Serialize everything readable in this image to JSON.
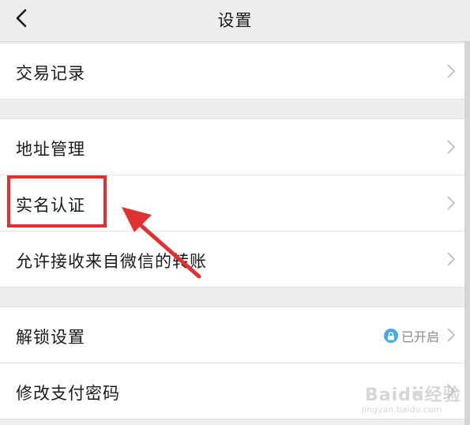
{
  "header": {
    "title": "设置"
  },
  "groups": [
    {
      "items": [
        {
          "label": "交易记录"
        }
      ]
    },
    {
      "items": [
        {
          "label": "地址管理"
        },
        {
          "label": "实名认证"
        },
        {
          "label": "允许接收来自微信的转账"
        }
      ]
    },
    {
      "items": [
        {
          "label": "解锁设置",
          "status": "已开启"
        },
        {
          "label": "修改支付密码"
        }
      ]
    }
  ],
  "annotation": {
    "highlight_color": "#e03131",
    "highlighted_item": "实名认证"
  },
  "watermark": {
    "brand": "Baidu经验",
    "url": "jingyan.baidu.com"
  },
  "colors": {
    "background": "#ededed",
    "cell": "#ffffff",
    "lock_badge": "#4aa7e8"
  }
}
